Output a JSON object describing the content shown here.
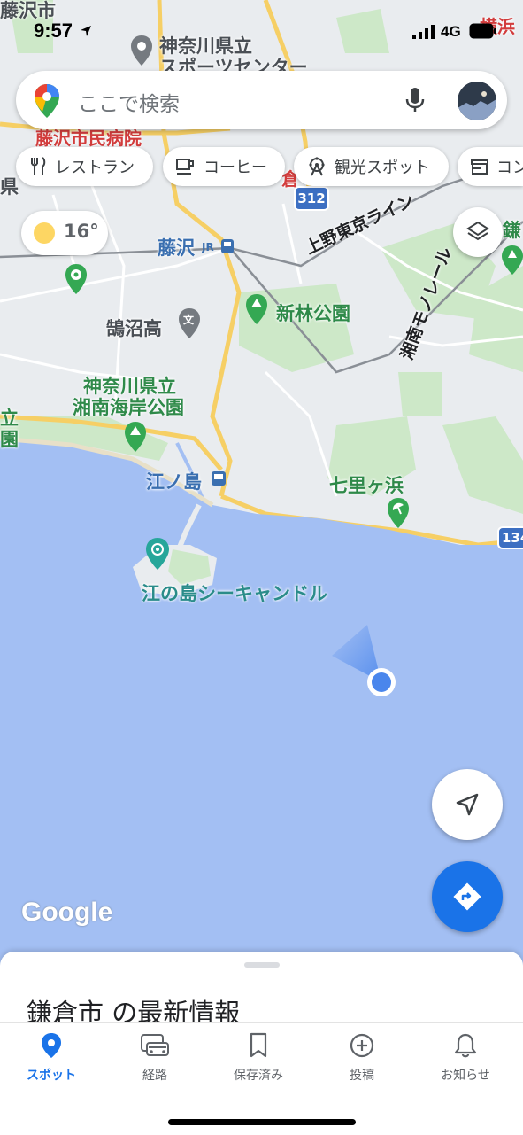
{
  "status_bar": {
    "time": "9:57",
    "network": "4G"
  },
  "search": {
    "placeholder": "ここで検索"
  },
  "chips": [
    {
      "label": "レストラン",
      "icon": "fork-knife-icon"
    },
    {
      "label": "コーヒー",
      "icon": "coffee-cup-icon"
    },
    {
      "label": "観光スポット",
      "icon": "ferris-wheel-icon"
    },
    {
      "label": "コン",
      "icon": "store-icon"
    }
  ],
  "weather": {
    "temp": "16°",
    "icon": "sun-icon"
  },
  "map_labels": {
    "fujisawa_city": "藤沢市",
    "yokohama": "横浜",
    "sports_center_1": "神奈川県立",
    "sports_center_2": "スポーツセンター",
    "hospital": "藤沢市民病院",
    "route_312": "312",
    "route_134": "134",
    "fujisawa_station": "藤沢",
    "ueno_tokyo_line": "上野東京ライン",
    "shonan_monorail": "湘南モノレール",
    "kutsunuma_high": "鵠沼高",
    "shinbayashi_park": "新林公園",
    "kamakura": "鎌",
    "coast_park_1": "神奈川県立",
    "coast_park_2": "湘南海岸公園",
    "enoshima_station": "江ノ島",
    "shichirigahama": "七里ヶ浜",
    "sea_candle": "江の島シーキャンドル",
    "left_edge_1": "立",
    "left_edge_2": "園",
    "left_edge_3": "県",
    "hospital_kura": "倉",
    "google": "Google"
  },
  "sheet": {
    "title": "鎌倉市 の最新情報"
  },
  "bottom_nav": [
    {
      "label": "スポット",
      "icon": "location-pin-icon",
      "active": true
    },
    {
      "label": "経路",
      "icon": "car-icon",
      "active": false
    },
    {
      "label": "保存済み",
      "icon": "bookmark-icon",
      "active": false
    },
    {
      "label": "投稿",
      "icon": "plus-circle-icon",
      "active": false
    },
    {
      "label": "お知らせ",
      "icon": "bell-icon",
      "active": false
    }
  ],
  "colors": {
    "water": "#a3bff3",
    "land": "#e9ecef",
    "park": "#cde8c8",
    "accent_blue": "#1a73e8",
    "road_yellow": "#f6cf65"
  }
}
